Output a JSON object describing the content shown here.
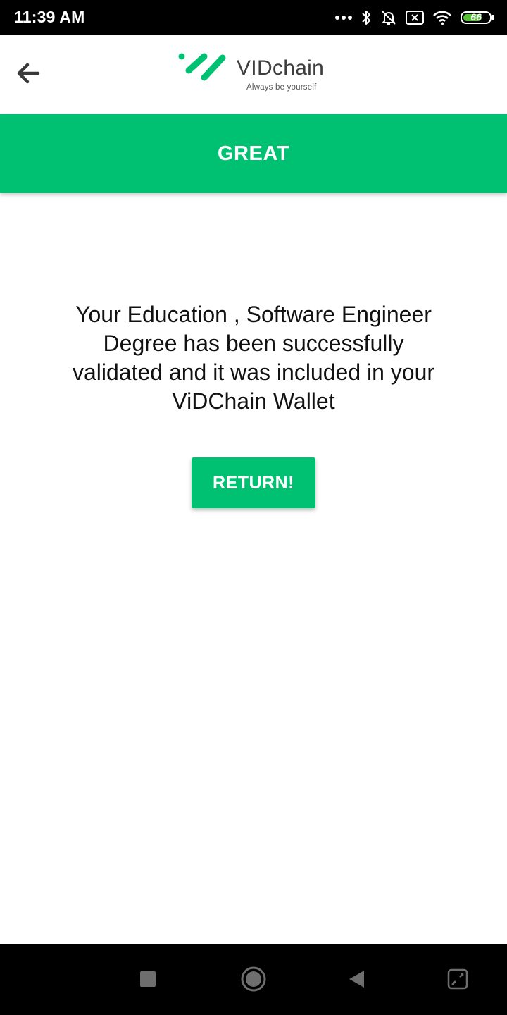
{
  "status_bar": {
    "time": "11:39 AM",
    "battery_level": "66",
    "icons": [
      "more-dots-icon",
      "bluetooth-icon",
      "bell-muted-icon",
      "sim-x-icon",
      "wifi-icon",
      "battery-icon"
    ]
  },
  "header": {
    "back_icon": "arrow-left-icon",
    "logo_name": "VIDchain",
    "logo_tagline": "Always be yourself"
  },
  "banner": {
    "title": "GREAT"
  },
  "main": {
    "message": "Your Education , Software Engineer Degree has been successfully validated and it was included in your ViDChain Wallet",
    "return_label": "RETURN!"
  },
  "nav_bar": {
    "icons": [
      "square-recents-icon",
      "circle-home-icon",
      "triangle-back-icon",
      "screen-expand-icon"
    ]
  },
  "colors": {
    "accent": "#00c172",
    "status_bar": "#000000",
    "text": "#111111"
  }
}
